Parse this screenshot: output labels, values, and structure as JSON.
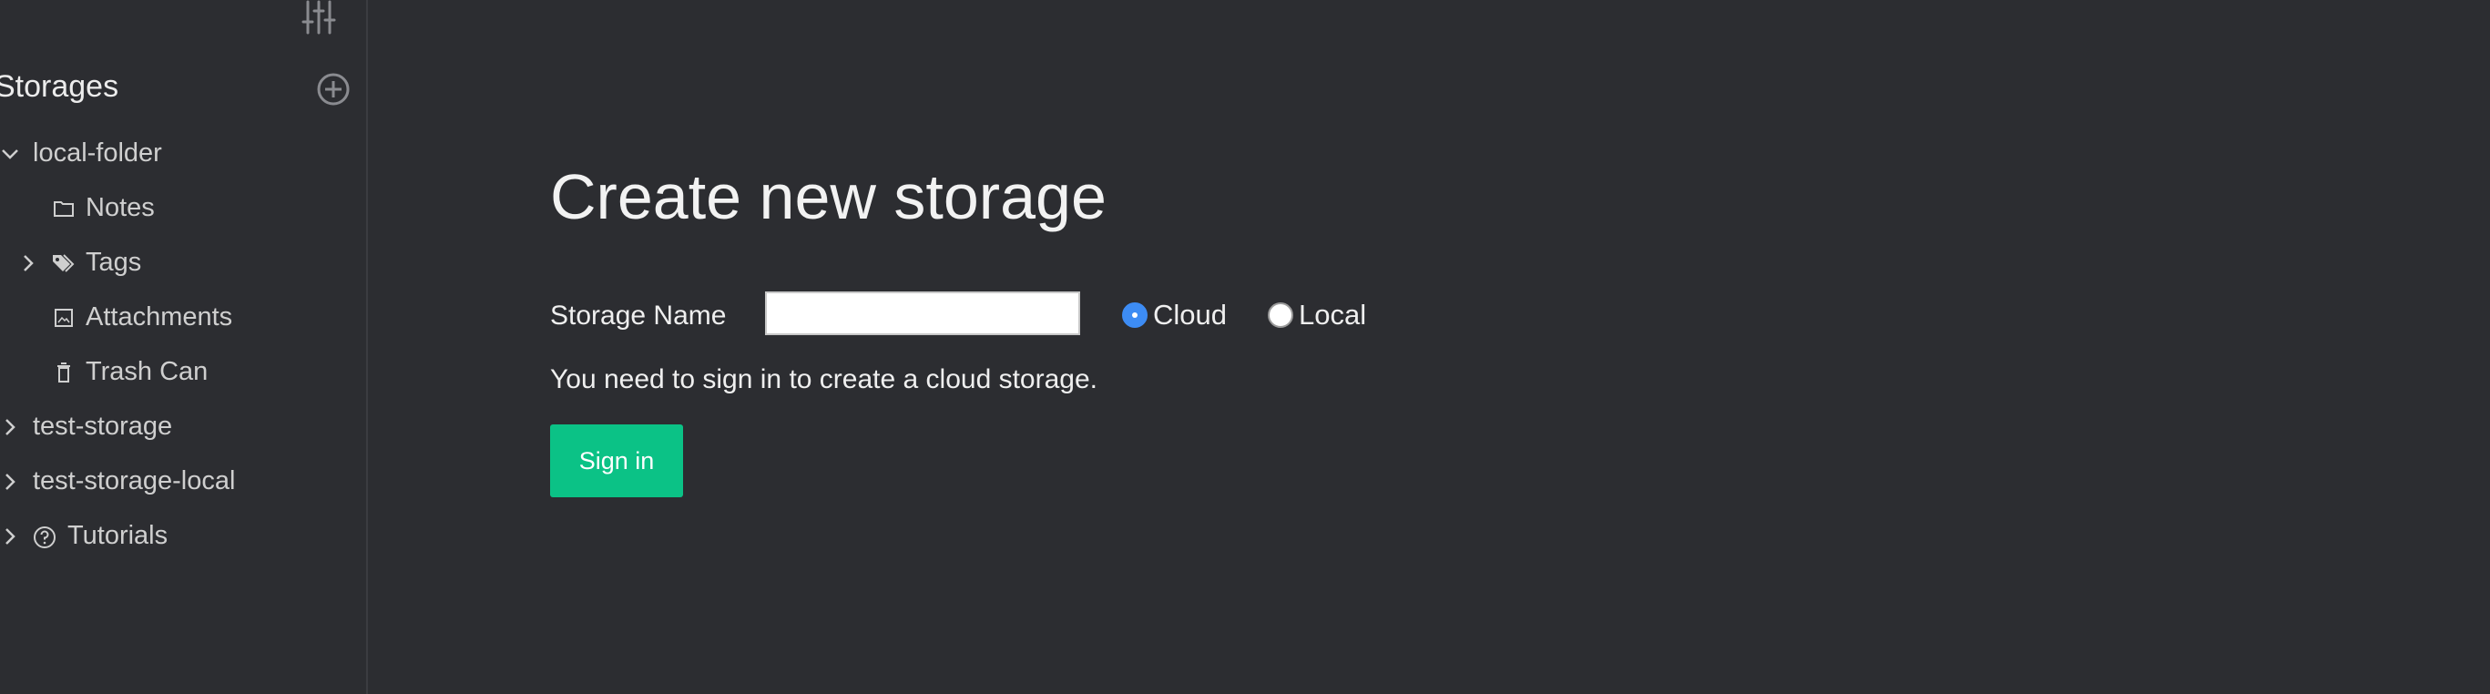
{
  "sidebar": {
    "top_icon": "sliders-icon",
    "storages_title": "Storages",
    "add_icon": "add-circle-icon",
    "items": [
      {
        "label": "local-folder",
        "expanded": true,
        "icon": "chevron-down-icon"
      },
      {
        "label": "Notes",
        "icon": "folder-icon"
      },
      {
        "label": "Tags",
        "icon": "tags-icon",
        "chevron": "chevron-right-icon"
      },
      {
        "label": "Attachments",
        "icon": "image-icon"
      },
      {
        "label": "Trash Can",
        "icon": "trash-icon"
      },
      {
        "label": "test-storage",
        "icon": "chevron-right-icon"
      },
      {
        "label": "test-storage-local",
        "icon": "chevron-right-icon"
      },
      {
        "label": "Tutorials",
        "icon": "help-circle-icon",
        "chevron": "chevron-right-icon"
      }
    ]
  },
  "main": {
    "title": "Create new storage",
    "storage_name_label": "Storage Name",
    "storage_name_value": "",
    "storage_type_options": [
      {
        "label": "Cloud",
        "selected": true
      },
      {
        "label": "Local",
        "selected": false
      }
    ],
    "info_text": "You need to sign in to create a cloud storage.",
    "sign_in_label": "Sign in"
  },
  "colors": {
    "background": "#2c2d31",
    "accent_green": "#0bc286",
    "radio_blue": "#3d8cf4"
  }
}
